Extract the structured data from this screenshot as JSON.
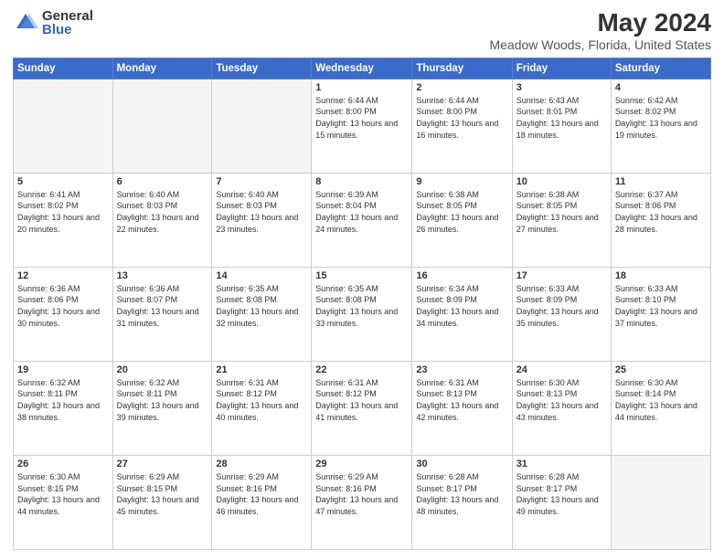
{
  "header": {
    "logo_general": "General",
    "logo_blue": "Blue",
    "title": "May 2024",
    "subtitle": "Meadow Woods, Florida, United States"
  },
  "days_of_week": [
    "Sunday",
    "Monday",
    "Tuesday",
    "Wednesday",
    "Thursday",
    "Friday",
    "Saturday"
  ],
  "weeks": [
    [
      {
        "day": "",
        "info": ""
      },
      {
        "day": "",
        "info": ""
      },
      {
        "day": "",
        "info": ""
      },
      {
        "day": "1",
        "info": "Sunrise: 6:44 AM\nSunset: 8:00 PM\nDaylight: 13 hours and 15 minutes."
      },
      {
        "day": "2",
        "info": "Sunrise: 6:44 AM\nSunset: 8:00 PM\nDaylight: 13 hours and 16 minutes."
      },
      {
        "day": "3",
        "info": "Sunrise: 6:43 AM\nSunset: 8:01 PM\nDaylight: 13 hours and 18 minutes."
      },
      {
        "day": "4",
        "info": "Sunrise: 6:42 AM\nSunset: 8:02 PM\nDaylight: 13 hours and 19 minutes."
      }
    ],
    [
      {
        "day": "5",
        "info": "Sunrise: 6:41 AM\nSunset: 8:02 PM\nDaylight: 13 hours and 20 minutes."
      },
      {
        "day": "6",
        "info": "Sunrise: 6:40 AM\nSunset: 8:03 PM\nDaylight: 13 hours and 22 minutes."
      },
      {
        "day": "7",
        "info": "Sunrise: 6:40 AM\nSunset: 8:03 PM\nDaylight: 13 hours and 23 minutes."
      },
      {
        "day": "8",
        "info": "Sunrise: 6:39 AM\nSunset: 8:04 PM\nDaylight: 13 hours and 24 minutes."
      },
      {
        "day": "9",
        "info": "Sunrise: 6:38 AM\nSunset: 8:05 PM\nDaylight: 13 hours and 26 minutes."
      },
      {
        "day": "10",
        "info": "Sunrise: 6:38 AM\nSunset: 8:05 PM\nDaylight: 13 hours and 27 minutes."
      },
      {
        "day": "11",
        "info": "Sunrise: 6:37 AM\nSunset: 8:06 PM\nDaylight: 13 hours and 28 minutes."
      }
    ],
    [
      {
        "day": "12",
        "info": "Sunrise: 6:36 AM\nSunset: 8:06 PM\nDaylight: 13 hours and 30 minutes."
      },
      {
        "day": "13",
        "info": "Sunrise: 6:36 AM\nSunset: 8:07 PM\nDaylight: 13 hours and 31 minutes."
      },
      {
        "day": "14",
        "info": "Sunrise: 6:35 AM\nSunset: 8:08 PM\nDaylight: 13 hours and 32 minutes."
      },
      {
        "day": "15",
        "info": "Sunrise: 6:35 AM\nSunset: 8:08 PM\nDaylight: 13 hours and 33 minutes."
      },
      {
        "day": "16",
        "info": "Sunrise: 6:34 AM\nSunset: 8:09 PM\nDaylight: 13 hours and 34 minutes."
      },
      {
        "day": "17",
        "info": "Sunrise: 6:33 AM\nSunset: 8:09 PM\nDaylight: 13 hours and 35 minutes."
      },
      {
        "day": "18",
        "info": "Sunrise: 6:33 AM\nSunset: 8:10 PM\nDaylight: 13 hours and 37 minutes."
      }
    ],
    [
      {
        "day": "19",
        "info": "Sunrise: 6:32 AM\nSunset: 8:11 PM\nDaylight: 13 hours and 38 minutes."
      },
      {
        "day": "20",
        "info": "Sunrise: 6:32 AM\nSunset: 8:11 PM\nDaylight: 13 hours and 39 minutes."
      },
      {
        "day": "21",
        "info": "Sunrise: 6:31 AM\nSunset: 8:12 PM\nDaylight: 13 hours and 40 minutes."
      },
      {
        "day": "22",
        "info": "Sunrise: 6:31 AM\nSunset: 8:12 PM\nDaylight: 13 hours and 41 minutes."
      },
      {
        "day": "23",
        "info": "Sunrise: 6:31 AM\nSunset: 8:13 PM\nDaylight: 13 hours and 42 minutes."
      },
      {
        "day": "24",
        "info": "Sunrise: 6:30 AM\nSunset: 8:13 PM\nDaylight: 13 hours and 43 minutes."
      },
      {
        "day": "25",
        "info": "Sunrise: 6:30 AM\nSunset: 8:14 PM\nDaylight: 13 hours and 44 minutes."
      }
    ],
    [
      {
        "day": "26",
        "info": "Sunrise: 6:30 AM\nSunset: 8:15 PM\nDaylight: 13 hours and 44 minutes."
      },
      {
        "day": "27",
        "info": "Sunrise: 6:29 AM\nSunset: 8:15 PM\nDaylight: 13 hours and 45 minutes."
      },
      {
        "day": "28",
        "info": "Sunrise: 6:29 AM\nSunset: 8:16 PM\nDaylight: 13 hours and 46 minutes."
      },
      {
        "day": "29",
        "info": "Sunrise: 6:29 AM\nSunset: 8:16 PM\nDaylight: 13 hours and 47 minutes."
      },
      {
        "day": "30",
        "info": "Sunrise: 6:28 AM\nSunset: 8:17 PM\nDaylight: 13 hours and 48 minutes."
      },
      {
        "day": "31",
        "info": "Sunrise: 6:28 AM\nSunset: 8:17 PM\nDaylight: 13 hours and 49 minutes."
      },
      {
        "day": "",
        "info": ""
      }
    ]
  ]
}
